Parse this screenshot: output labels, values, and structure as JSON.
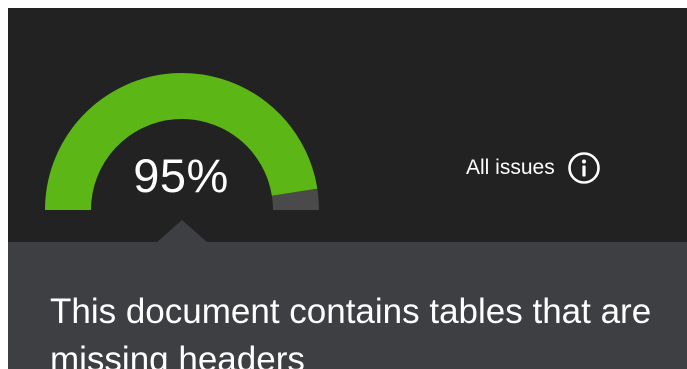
{
  "score": {
    "percent_text": "95%",
    "value": 0.95,
    "fill_color": "#5cb615",
    "track_color": "#4a4a4a"
  },
  "all_issues": {
    "label": "All issues",
    "icon": "info-circle-icon"
  },
  "issue": {
    "message": "This document contains tables that are missing headers"
  }
}
